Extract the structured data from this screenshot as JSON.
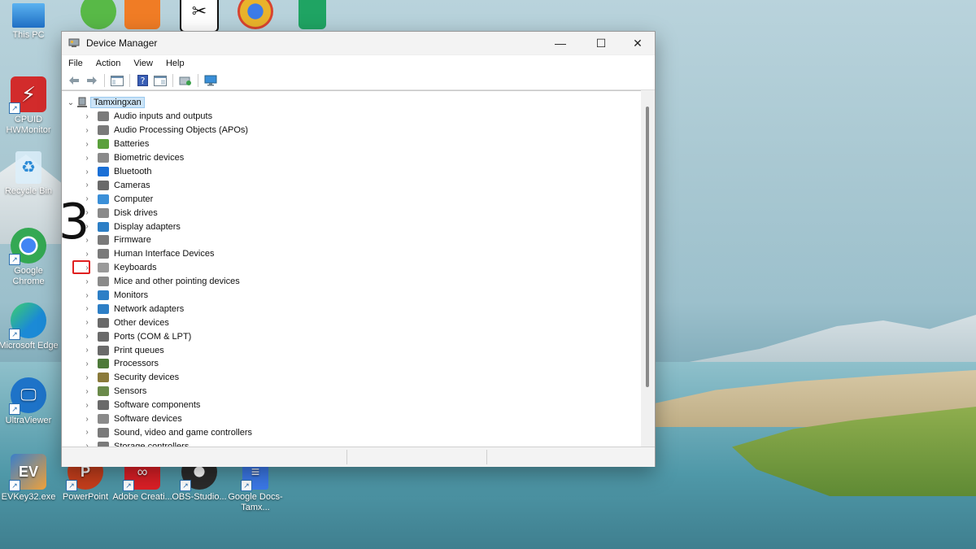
{
  "annotation_number": "3",
  "desktop": {
    "icons": [
      {
        "label": "This PC",
        "color": "#2f8de0",
        "left": 0,
        "top": 0
      },
      {
        "label": "CPUID HWMonitor",
        "color": "#d22b2b"
      },
      {
        "label": "Recycle Bin",
        "color": "#cfe6f5"
      },
      {
        "label": "Google Chrome",
        "color": "#34a853"
      },
      {
        "label": "Microsoft Edge",
        "color": "#1b8ad6"
      },
      {
        "label": "UltraViewer",
        "color": "#1e73c8"
      },
      {
        "label": "EVKey32.exe",
        "color": "#3a7fc9"
      },
      {
        "label": "PowerPoint",
        "color": "#c43e1c"
      },
      {
        "label": "Adobe Creati...",
        "color": "#da1f26"
      },
      {
        "label": "OBS-Studio...",
        "color": "#2b2b2b"
      },
      {
        "label": "Google Docs-Tamx...",
        "color": "#3b78e7"
      }
    ],
    "top_icons": [
      {
        "name": "coc-coc-icon",
        "color": "#58b947"
      },
      {
        "name": "foxit-icon",
        "color": "#f07c25"
      },
      {
        "name": "capcut-icon",
        "color": "#111111"
      },
      {
        "name": "chrome-canary-icon",
        "color": "#e9b32b"
      },
      {
        "name": "google-sheets-icon",
        "color": "#1fa463"
      }
    ]
  },
  "window": {
    "title": "Device Manager",
    "controls": {
      "minimize": "—",
      "maximize": "☐",
      "close": "✕"
    },
    "menu": [
      "File",
      "Action",
      "View",
      "Help"
    ],
    "tree": {
      "root": "Tamxingxan",
      "items": [
        {
          "label": "Audio inputs and outputs",
          "color": "#7a7a7a"
        },
        {
          "label": "Audio Processing Objects (APOs)",
          "color": "#7a7a7a"
        },
        {
          "label": "Batteries",
          "color": "#5aa03c"
        },
        {
          "label": "Biometric devices",
          "color": "#8a8a8a"
        },
        {
          "label": "Bluetooth",
          "color": "#1a6fd6"
        },
        {
          "label": "Cameras",
          "color": "#6a6a6a"
        },
        {
          "label": "Computer",
          "color": "#3a8fd8"
        },
        {
          "label": "Disk drives",
          "color": "#8a8a8a"
        },
        {
          "label": "Display adapters",
          "color": "#2d7fc6"
        },
        {
          "label": "Firmware",
          "color": "#7a7a7a"
        },
        {
          "label": "Human Interface Devices",
          "color": "#7a7a7a"
        },
        {
          "label": "Keyboards",
          "color": "#9a9a9a"
        },
        {
          "label": "Mice and other pointing devices",
          "color": "#8a8a8a"
        },
        {
          "label": "Monitors",
          "color": "#2d7fc6"
        },
        {
          "label": "Network adapters",
          "color": "#2d7fc6"
        },
        {
          "label": "Other devices",
          "color": "#6a6a6a"
        },
        {
          "label": "Ports (COM & LPT)",
          "color": "#6a6a6a"
        },
        {
          "label": "Print queues",
          "color": "#6a6a6a"
        },
        {
          "label": "Processors",
          "color": "#4e7a3a"
        },
        {
          "label": "Security devices",
          "color": "#8a7a3a"
        },
        {
          "label": "Sensors",
          "color": "#6a8a4a"
        },
        {
          "label": "Software components",
          "color": "#6a6a6a"
        },
        {
          "label": "Software devices",
          "color": "#8a8a8a"
        },
        {
          "label": "Sound, video and game controllers",
          "color": "#7a7a7a"
        },
        {
          "label": "Storage controllers",
          "color": "#7a7a7a"
        }
      ],
      "highlighted_item": "Keyboards"
    }
  }
}
